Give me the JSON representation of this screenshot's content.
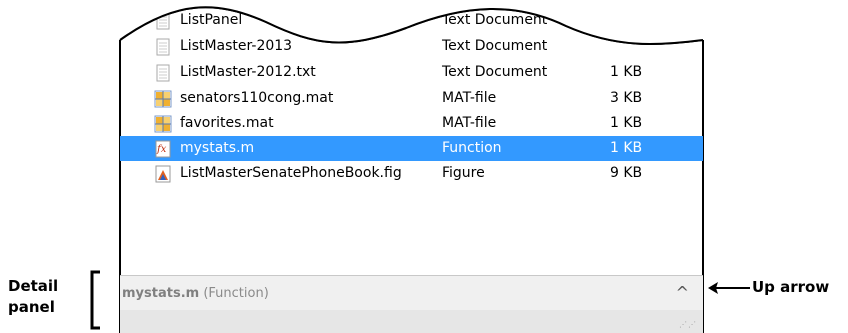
{
  "files": [
    {
      "name": "ListPanel",
      "type": "Text Document",
      "size": "",
      "icon": "text-file-icon"
    },
    {
      "name": "ListMaster-2013",
      "type": "Text Document",
      "size": "",
      "icon": "text-file-icon"
    },
    {
      "name": "ListMaster-2012.txt",
      "type": "Text Document",
      "size": "1 KB",
      "icon": "text-file-icon"
    },
    {
      "name": "senators110cong.mat",
      "type": "MAT-file",
      "size": "3 KB",
      "icon": "mat-file-icon"
    },
    {
      "name": "favorites.mat",
      "type": "MAT-file",
      "size": "1 KB",
      "icon": "mat-file-icon"
    },
    {
      "name": "mystats.m",
      "type": "Function",
      "size": "1 KB",
      "icon": "function-file-icon",
      "selected": true
    },
    {
      "name": "ListMasterSenatePhoneBook.fig",
      "type": "Figure",
      "size": "9 KB",
      "icon": "figure-file-icon"
    }
  ],
  "detail_panel": {
    "name": "mystats.m",
    "type": "(Function)",
    "arrow_glyph": "^"
  },
  "callouts": {
    "detail_line1": "Detail",
    "detail_line2": "panel",
    "up_arrow": "Up arrow"
  },
  "colors": {
    "selection": "#3399ff",
    "detail_background": "#f0f0f0",
    "footer_background": "#e6e6e6"
  }
}
